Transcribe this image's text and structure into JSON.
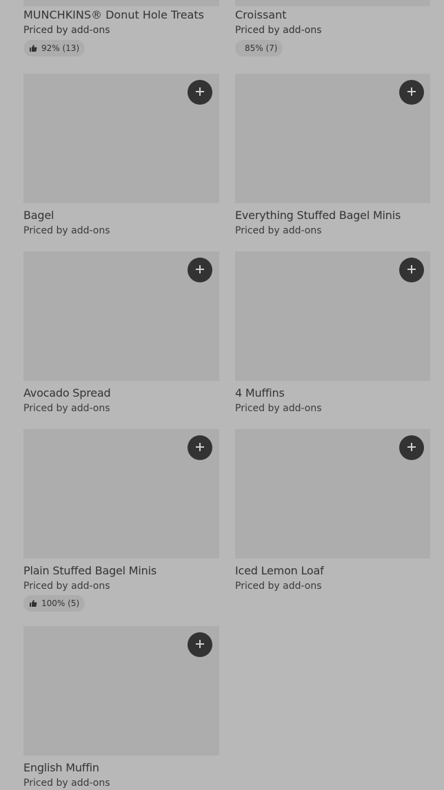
{
  "items": [
    {
      "name": "MUNCHKINS® Donut Hole Treats",
      "price": "Priced by add-ons",
      "rating": "92% (13)"
    },
    {
      "name": "Croissant",
      "price": "Priced by add-ons",
      "rating": "85% (7)"
    },
    {
      "name": "Bagel",
      "price": "Priced by add-ons"
    },
    {
      "name": "Everything Stuffed Bagel Minis",
      "price": "Priced by add-ons"
    },
    {
      "name": "Avocado Spread",
      "price": "Priced by add-ons"
    },
    {
      "name": "4 Muffins",
      "price": "Priced by add-ons"
    },
    {
      "name": "Plain Stuffed Bagel Minis",
      "price": "Priced by add-ons",
      "rating": "100% (5)"
    },
    {
      "name": "Iced Lemon Loaf",
      "price": "Priced by add-ons"
    },
    {
      "name": "English Muffin",
      "price": "Priced by add-ons"
    }
  ],
  "icons": {
    "add": "plus-icon",
    "rating": "thumbs-up-icon"
  },
  "colors": {
    "background": "#b8b8b8",
    "image_placeholder": "#adadad",
    "button": "#333333"
  }
}
